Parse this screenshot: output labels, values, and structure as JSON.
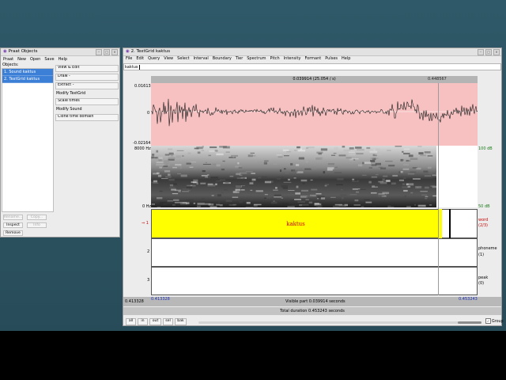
{
  "objects_window": {
    "title": "Praat Objects",
    "menu": [
      "Praat",
      "New",
      "Open",
      "Save",
      "Help"
    ],
    "objects_label": "Objects:",
    "objects": [
      "1. Sound kaktus",
      "2. TextGrid kaktus"
    ],
    "commands": {
      "view_edit": "View & Edit",
      "draw": "Draw -",
      "extract": "Extract -",
      "modify_textgrid_header": "Modify TextGrid",
      "scale_times": "Scale times",
      "modify_sound_header": "Modify Sound",
      "clone_time_domain": "Clone time domain"
    },
    "bottom_buttons": {
      "rename": "Rename...",
      "copy": "Copy...",
      "inspect": "Inspect",
      "info": "Info",
      "remove": "Remove"
    }
  },
  "textgrid_window": {
    "title": "2. TextGrid kaktus",
    "menu": [
      "File",
      "Edit",
      "Query",
      "View",
      "Select",
      "Interval",
      "Boundary",
      "Tier",
      "Spectrum",
      "Pitch",
      "Intensity",
      "Formant",
      "Pulses",
      "Help"
    ],
    "text_field_value": "kaktus",
    "selection_header": "0.039914 (25.054 / s)",
    "cursor_time": "0.448567",
    "waveform": {
      "max_label": "0.01613",
      "zero_label": "0",
      "min_label": "-0.02164"
    },
    "spectrogram": {
      "top_freq": "8000 Hz",
      "bottom_freq": "0 Hz",
      "top_db": "100 dB",
      "bottom_db": "50 dB"
    },
    "tiers": [
      {
        "number": "1",
        "arrow": "⇒",
        "name": "word",
        "count": "(2/3)",
        "interval_text": "kaktus"
      },
      {
        "number": "2",
        "name": "phoneme",
        "count": "(1)"
      },
      {
        "number": "3",
        "name": "peak",
        "count": "(0)"
      }
    ],
    "bottom": {
      "left_outer": "0.413328",
      "left_inner": "0.413328",
      "visible_part": "Visible part 0.039914 seconds",
      "right_time": "0.453243",
      "total_duration": "Total duration 0.453243 seconds"
    },
    "nav_buttons": [
      "all",
      "in",
      "out",
      "sel",
      "bak"
    ],
    "group_label": "Group",
    "group_checked": "✓"
  },
  "colors": {
    "waveform_bg": "#f7c1c1",
    "selected_interval": "#ffff00",
    "tier_label": "#cc0000",
    "time_blue": "#1a2fb0"
  }
}
